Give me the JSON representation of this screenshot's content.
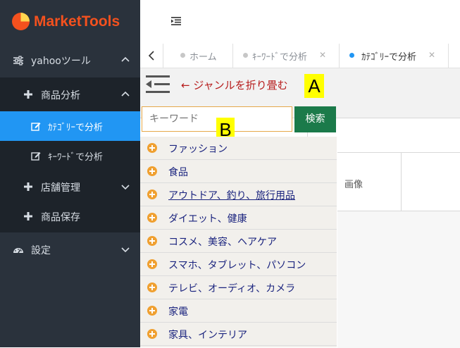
{
  "brand": {
    "name": "MarketTools",
    "color": "#f4511e"
  },
  "sidebar": {
    "groups": [
      {
        "label": "yahooツール",
        "icon": "sliders-icon"
      },
      {
        "label": "設定",
        "icon": "dashboard-icon"
      }
    ],
    "items": [
      {
        "label": "商品分析",
        "icon": "plus-icon"
      },
      {
        "label": "ｶﾃｺﾞﾘｰで分析",
        "icon": "edit-icon",
        "active": true
      },
      {
        "label": "ｷｰﾜｰﾄﾞで分析",
        "icon": "edit-icon"
      },
      {
        "label": "店舗管理",
        "icon": "plus-icon"
      },
      {
        "label": "商品保存",
        "icon": "plus-icon"
      }
    ]
  },
  "tabs": [
    {
      "label": "ホーム"
    },
    {
      "label": "ｷｰﾜｰﾄﾞで分析"
    },
    {
      "label": "ｶﾃｺﾞﾘｰで分析",
      "active": true
    }
  ],
  "main": {
    "annotation": "← ジャンルを折り畳む",
    "badge_a": "A",
    "badge_b": "B",
    "search": {
      "placeholder": "キーワード",
      "button": "検索"
    },
    "table": {
      "col_image": "画像"
    },
    "genres": [
      "ファッション",
      "食品",
      "アウトドア、釣り、旅行用品",
      "ダイエット、健康",
      "コスメ、美容、ヘアケア",
      "スマホ、タブレット、パソコン",
      "テレビ、オーディオ、カメラ",
      "家電",
      "家具、インテリア"
    ]
  },
  "colors": {
    "sidebar": "#2a323c",
    "active": "#2196f3",
    "search_button": "#1b7a4a",
    "plus": "#f0a030"
  }
}
